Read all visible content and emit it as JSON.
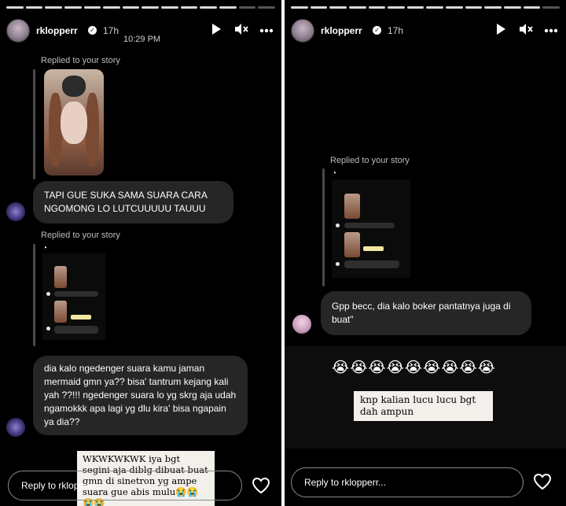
{
  "left": {
    "username": "rklopperr",
    "time_ago": "17h",
    "clock": "10:29 PM",
    "replied_label_1": "Replied to your story",
    "message_1": "TAPI GUE SUKA SAMA SUARA CARA NGOMONG LO LUTCUUUUU TAUUU",
    "replied_label_2": "Replied to your story",
    "message_2": "dia kalo ngedenger suara kamu jaman mermaid gmn ya?? bisa' tantrum kejang kali yah ??!!! ngedenger suara lo yg skrg aja udah ngamokkk apa lagi yg dlu kira' bisa ngapain ya dia??",
    "overlay_caption": "WKWKWKWK iya bgt segini aja diblɡ dibuat buat gmn di sinetron yg ampe suara gue abis mulu😭😭😭😭",
    "reply_placeholder": "Reply to rklopperr..."
  },
  "right": {
    "username": "rklopperr",
    "time_ago": "17h",
    "replied_label": "Replied to your story",
    "message": "Gpp becc, dia kalo boker pantatnya juga di buat\"",
    "emoji_row": "😭😭😭😭😭😭😭😭😭",
    "caption": "knp kalian lucu lucu bgt dah ampun",
    "reply_placeholder": "Reply to rklopperr..."
  },
  "icons": [
    "play-icon",
    "mute-icon",
    "more-icon",
    "heart-icon",
    "verified-icon"
  ]
}
